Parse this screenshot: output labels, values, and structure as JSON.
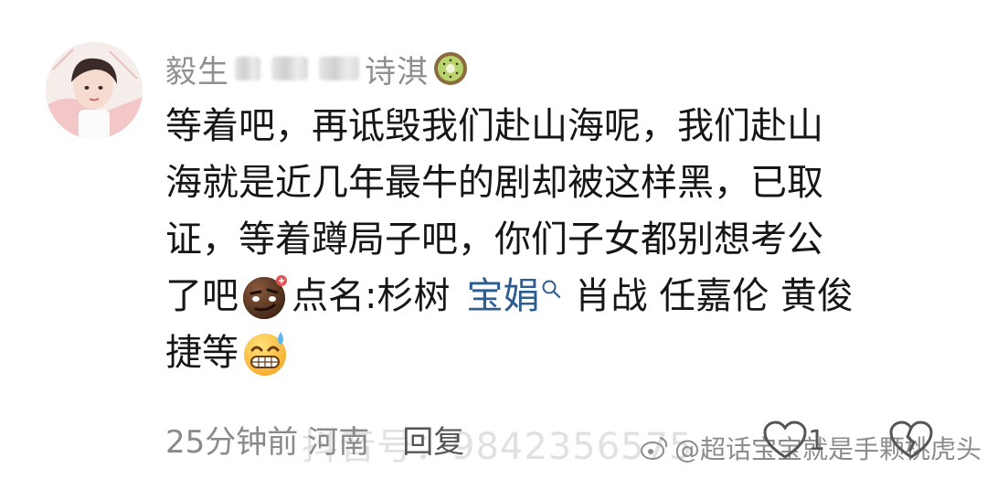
{
  "comment": {
    "username_prefix": "毅生",
    "username_suffix": "诗淇",
    "lines": [
      "等着吧，再诋毁我们赴山海呢，我们赴山",
      "海就是近几年最牛的剧却被这样黑，已取",
      "证，等着蹲局子吧，你们子女都别想考公"
    ],
    "line4_start": "了吧",
    "line4_mid": "点名:杉树",
    "mention": "宝娟",
    "line4_end": "肖战 任嘉伦 黄俊",
    "line5": "捷等"
  },
  "footer": {
    "time": "25分钟前",
    "location": "河南",
    "reply_label": "回复",
    "like_count": "1"
  },
  "watermark": {
    "douyin": "抖音号：9842356575",
    "weibo": "@超话宝宝就是手颗桃虎头"
  },
  "icons": {
    "avatar": "avatar-photo",
    "username_badge": "kiwi-icon",
    "emoji_1": "smirk-emoji-icon",
    "emoji_2": "sweat-grin-emoji-icon",
    "search": "search-icon",
    "like": "heart-icon",
    "dislike": "broken-heart-icon",
    "weibo": "weibo-icon"
  },
  "colors": {
    "mention": "#2e5d8f",
    "muted": "#8a8a8a",
    "text": "#161616"
  }
}
